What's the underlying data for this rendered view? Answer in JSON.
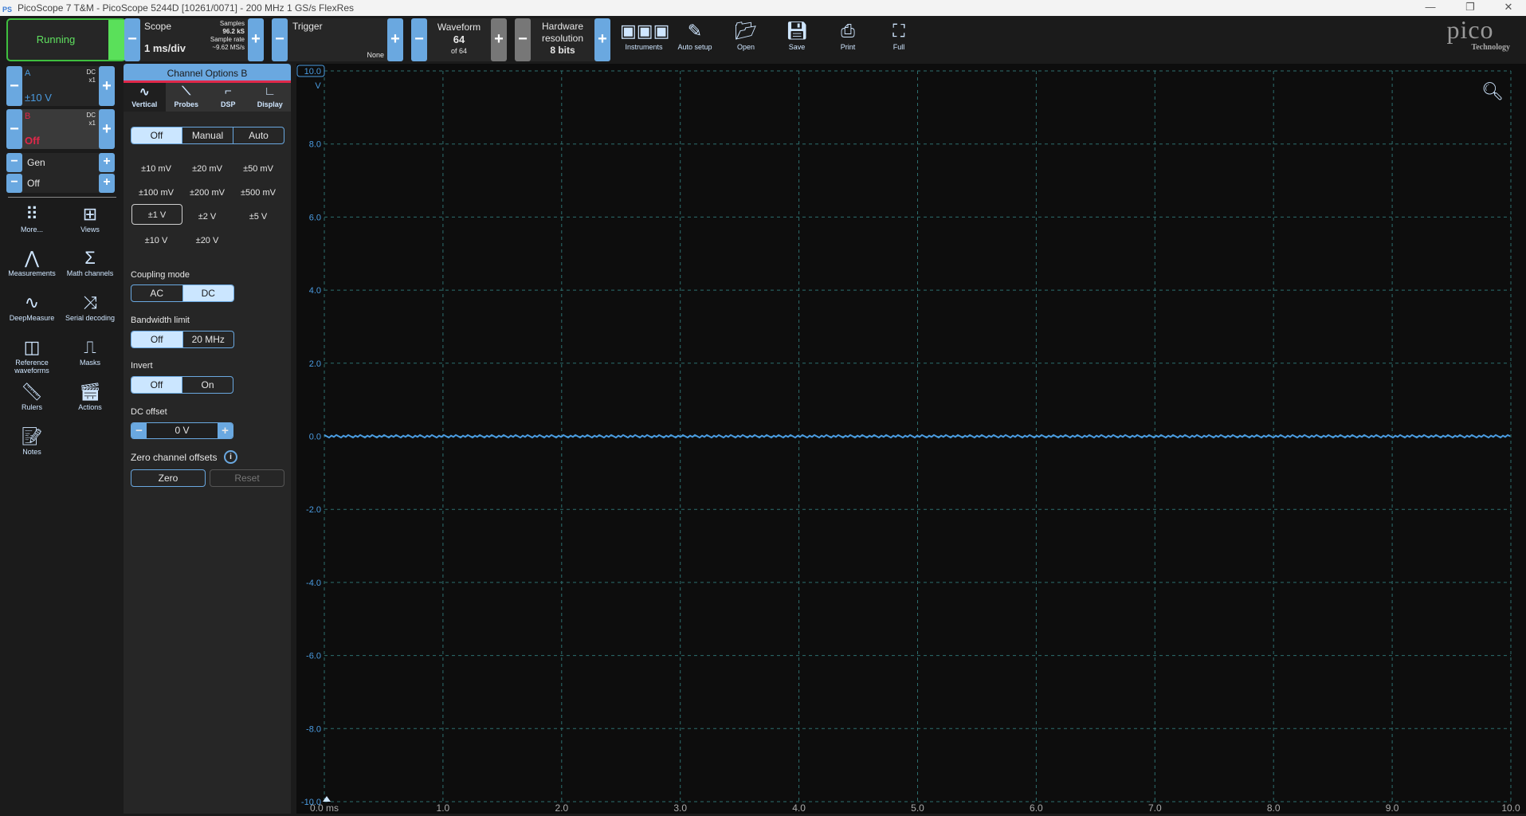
{
  "window": {
    "title": "PicoScope 7 T&M  - PicoScope 5244D [10261/0071] - 200 MHz 1 GS/s FlexRes",
    "minimize": "—",
    "restore": "❐",
    "close": "✕"
  },
  "toolbar": {
    "run_status": "Running",
    "scope": {
      "label": "Scope",
      "timebase": "1 ms/div",
      "samples_label": "Samples",
      "samples": "96.2 kS",
      "rate_label": "Sample rate",
      "rate": "~9.62 MS/s"
    },
    "trigger": {
      "label": "Trigger",
      "mode": "None"
    },
    "waveform": {
      "label": "Waveform",
      "current": "64",
      "total": "of 64"
    },
    "hw_res": {
      "label1": "Hardware",
      "label2": "resolution",
      "value": "8 bits"
    },
    "tools": [
      {
        "label": "Instruments",
        "icon": "instruments-icon"
      },
      {
        "label": "Auto setup",
        "icon": "auto-setup-icon"
      },
      {
        "label": "Open",
        "icon": "folder-icon"
      },
      {
        "label": "Save",
        "icon": "save-icon"
      },
      {
        "label": "Print",
        "icon": "print-icon"
      },
      {
        "label": "Full",
        "icon": "fullscreen-icon"
      }
    ],
    "brand": {
      "name": "pico",
      "sub": "Technology"
    }
  },
  "channels": {
    "a": {
      "name": "A",
      "coupling": "DC",
      "probe": "x1",
      "range": "±10 V",
      "color": "#4a9be0"
    },
    "b": {
      "name": "B",
      "coupling": "DC",
      "probe": "x1",
      "range": "Off",
      "color": "#e0284a"
    },
    "gen": {
      "name": "Gen",
      "state": "Off"
    }
  },
  "side_tools": [
    {
      "label": "More..."
    },
    {
      "label": "Views"
    },
    {
      "label": "Measurements"
    },
    {
      "label": "Math channels"
    },
    {
      "label": "DeepMeasure"
    },
    {
      "label": "Serial decoding"
    },
    {
      "label": "Reference waveforms"
    },
    {
      "label": "Masks"
    },
    {
      "label": "Rulers"
    },
    {
      "label": "Actions"
    },
    {
      "label": "Notes"
    }
  ],
  "options": {
    "title": "Channel Options  B",
    "tabs": [
      "Vertical",
      "Probes",
      "DSP",
      "Display"
    ],
    "range_mode": [
      "Off",
      "Manual",
      "Auto"
    ],
    "ranges": [
      "±10 mV",
      "±20 mV",
      "±50 mV",
      "±100 mV",
      "±200 mV",
      "±500 mV",
      "±1 V",
      "±2 V",
      "±5 V",
      "±10 V",
      "±20 V"
    ],
    "selected_range": "±1 V",
    "coupling_label": "Coupling mode",
    "coupling": [
      "AC",
      "DC"
    ],
    "bw_label": "Bandwidth limit",
    "bw": [
      "Off",
      "20 MHz"
    ],
    "invert_label": "Invert",
    "invert": [
      "Off",
      "On"
    ],
    "offset_label": "DC offset",
    "offset": "0 V",
    "zero_label": "Zero channel offsets",
    "zero_btn": "Zero",
    "reset_btn": "Reset"
  },
  "chart_data": {
    "type": "line",
    "xlabel": "ms",
    "ylabel": "V",
    "xlim": [
      0,
      10
    ],
    "ylim": [
      -10,
      10
    ],
    "x_ticks": [
      "0.0 ms",
      "1.0",
      "2.0",
      "3.0",
      "4.0",
      "5.0",
      "6.0",
      "7.0",
      "8.0",
      "9.0",
      "10.0"
    ],
    "y_ticks": [
      "10.0",
      "8.0",
      "6.0",
      "4.0",
      "2.0",
      "0.0",
      "-2.0",
      "-4.0",
      "-6.0",
      "-8.0",
      "-10.0"
    ],
    "y_unit": "V",
    "grid": true,
    "series": [
      {
        "name": "A",
        "color": "#4a9be0",
        "level": 0
      }
    ]
  }
}
